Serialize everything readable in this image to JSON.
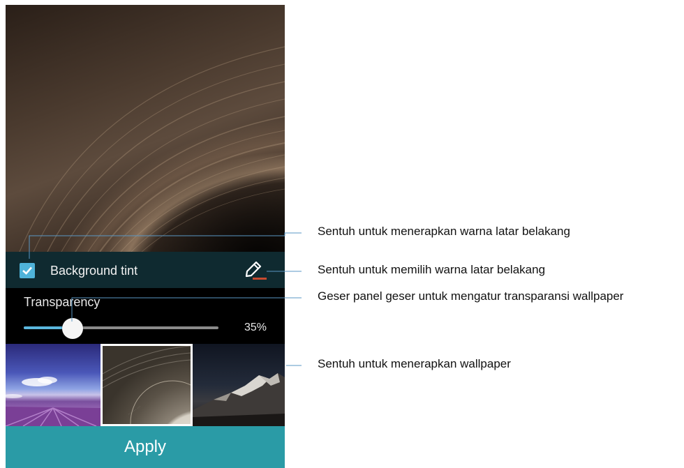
{
  "settings": {
    "background_tint_label": "Background tint",
    "background_tint_checked": true,
    "transparency_label": "Transparency",
    "transparency_value": "35%",
    "transparency_fraction": 0.35,
    "apply_label": "Apply"
  },
  "icons": {
    "checkbox": "checkmark-icon",
    "edit": "pencil-icon"
  },
  "wallpapers": [
    {
      "name": "lavender-field",
      "selected": false
    },
    {
      "name": "vinyl-record",
      "selected": true
    },
    {
      "name": "mountain-peak",
      "selected": false
    }
  ],
  "callouts": [
    "Sentuh untuk menerapkan warna latar belakang",
    "Sentuh untuk memilih warna latar belakang",
    "Geser panel geser untuk mengatur transparansi wallpaper",
    "Sentuh untuk menerapkan wallpaper"
  ],
  "colors": {
    "accent": "#4fb3d9",
    "apply_button": "#2a9ba6",
    "tint_row": "#0f2a30"
  }
}
